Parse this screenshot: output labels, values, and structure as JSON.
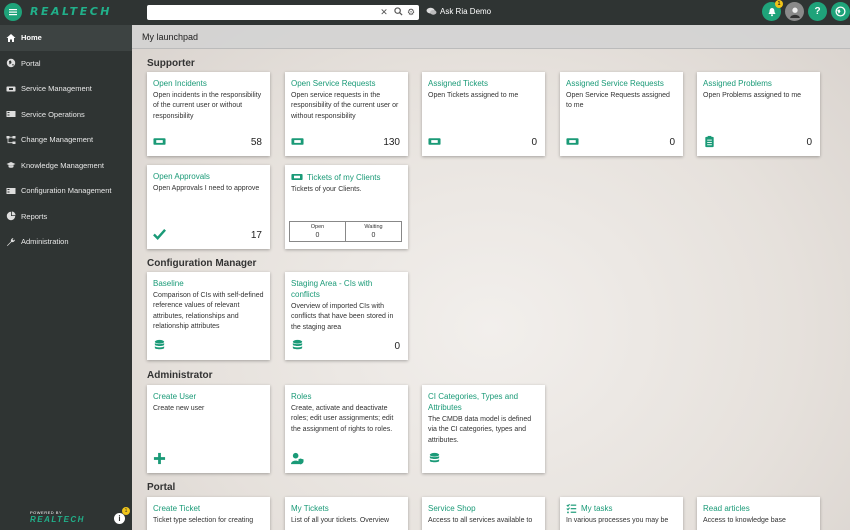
{
  "app": {
    "logo": "REALTECH",
    "ask": "Ask Ria Demo",
    "notify_count": "1"
  },
  "search": {
    "placeholder": ""
  },
  "sidebar": {
    "items": [
      {
        "label": "Home"
      },
      {
        "label": "Portal"
      },
      {
        "label": "Service Management"
      },
      {
        "label": "Service Operations"
      },
      {
        "label": "Change Management"
      },
      {
        "label": "Knowledge Management"
      },
      {
        "label": "Configuration Management"
      },
      {
        "label": "Reports"
      },
      {
        "label": "Administration"
      }
    ],
    "powered_by": "POWERED BY",
    "powered_logo": "REALTECH",
    "info_badge": "1"
  },
  "main": {
    "title": "My launchpad",
    "sections": {
      "supporter": "Supporter",
      "config": "Configuration Manager",
      "admin": "Administrator",
      "portal": "Portal"
    },
    "cards": {
      "open_incidents": {
        "title": "Open Incidents",
        "desc": "Open incidents in the responsibility of the current user or without responsibility",
        "count": "58"
      },
      "open_sr": {
        "title": "Open Service Requests",
        "desc": "Open service requests in the responsibility of the current user or without responsibility",
        "count": "130"
      },
      "assigned_tickets": {
        "title": "Assigned Tickets",
        "desc": "Open Tickets assigned to me",
        "count": "0"
      },
      "assigned_sr": {
        "title": "Assigned Service Requests",
        "desc": "Open Service Requests assigned to me",
        "count": "0"
      },
      "assigned_problems": {
        "title": "Assigned Problems",
        "desc": "Open Problems assigned to me",
        "count": "0"
      },
      "open_approvals": {
        "title": "Open Approvals",
        "desc": "Open Approvals I need to approve",
        "count": "17"
      },
      "tickets_clients": {
        "title": "Tickets of my Clients",
        "desc": "Tickets of your Clients.",
        "open_label": "Open",
        "open_value": "0",
        "waiting_label": "Waiting",
        "waiting_value": "0"
      },
      "baseline": {
        "title": "Baseline",
        "desc": "Comparison of CIs with self-defined reference values of relevant attributes, relationships and relationship attributes"
      },
      "staging": {
        "title": "Staging Area - CIs with conflicts",
        "desc": "Overview of imported CIs with conflicts that have been stored in the staging area",
        "count": "0"
      },
      "create_user": {
        "title": "Create User",
        "desc": "Create new user"
      },
      "roles": {
        "title": "Roles",
        "desc": "Create, activate and deactivate roles; edit user assignments; edit the assignment of rights to roles."
      },
      "ci_categories": {
        "title": "CI Categories, Types and Attributes",
        "desc": "The CMDB data model is defined via the CI categories, types and attributes."
      },
      "create_ticket": {
        "title": "Create Ticket",
        "desc": "Ticket type selection for creating"
      },
      "my_tickets": {
        "title": "My Tickets",
        "desc": "List of all your tickets. Overview"
      },
      "service_shop": {
        "title": "Service Shop",
        "desc": "Access to all services available to"
      },
      "my_tasks": {
        "title": "My tasks",
        "desc": "In various processes you may be"
      },
      "read_articles": {
        "title": "Read articles",
        "desc": "Access to knowledge base"
      }
    }
  }
}
